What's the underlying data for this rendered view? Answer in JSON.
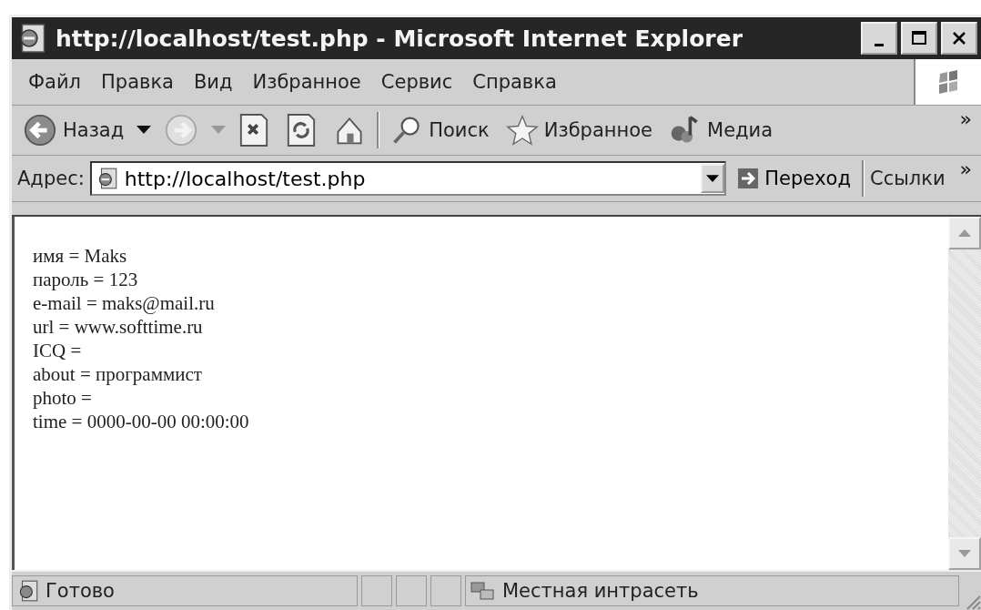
{
  "window": {
    "title": "http://localhost/test.php - Microsoft Internet Explorer"
  },
  "menu": [
    {
      "label": "Файл"
    },
    {
      "label": "Правка"
    },
    {
      "label": "Вид"
    },
    {
      "label": "Избранное"
    },
    {
      "label": "Сервис"
    },
    {
      "label": "Справка"
    }
  ],
  "toolbar": {
    "buttons": [
      {
        "kind": "back",
        "label": "Назад",
        "disabled": false,
        "dropdown": true
      },
      {
        "kind": "forward",
        "disabled": true,
        "dropdown": true
      },
      {
        "kind": "stop",
        "disabled": false
      },
      {
        "kind": "refresh",
        "disabled": false
      },
      {
        "kind": "home",
        "disabled": false
      },
      {
        "kind": "search",
        "label": "Поиск",
        "disabled": false
      },
      {
        "kind": "favorites",
        "label": "Избранное",
        "disabled": false
      },
      {
        "kind": "media",
        "label": "Медиа",
        "disabled": false
      }
    ],
    "more": "»"
  },
  "address": {
    "label": "Адрес:",
    "url": "http://localhost/test.php",
    "go": "Переход",
    "links": "Ссылки",
    "more": "»"
  },
  "content": {
    "lines": [
      "имя = Maks",
      "пароль = 123",
      "e-mail = maks@mail.ru",
      "url = www.softtime.ru",
      "ICQ =",
      "about = программист",
      "photo =",
      "time = 0000-00-00 00:00:00"
    ]
  },
  "status_bar": {
    "text": "Готово",
    "zone": "Местная интрасеть"
  }
}
